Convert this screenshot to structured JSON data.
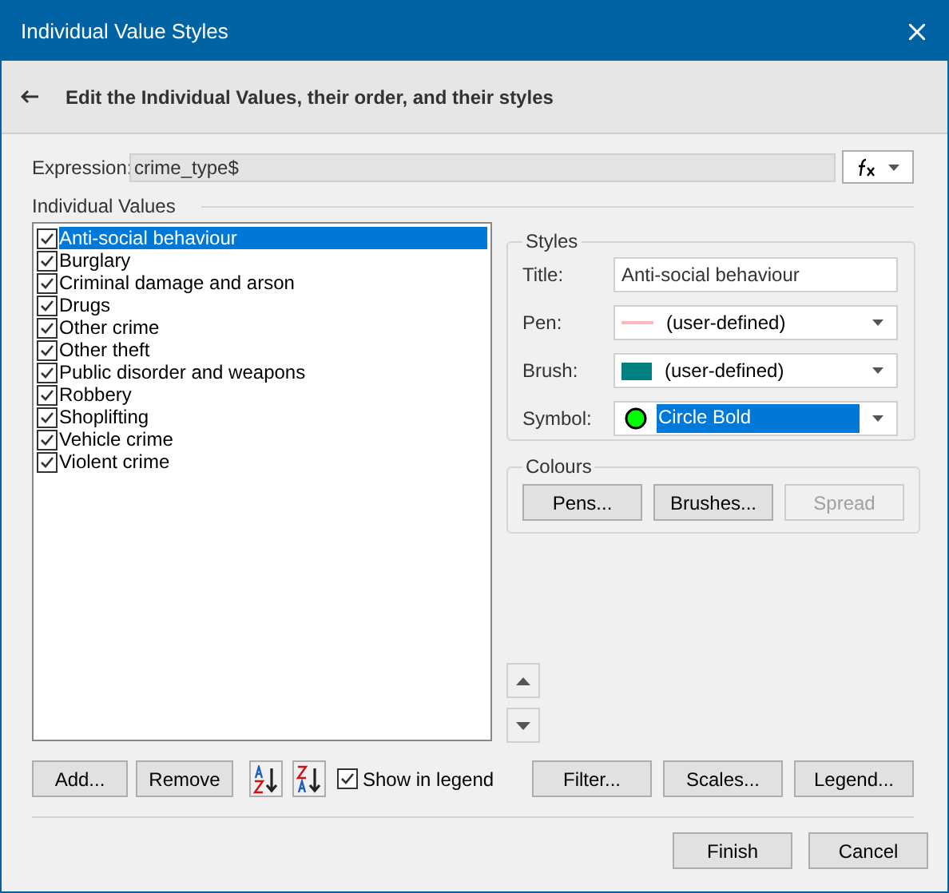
{
  "window": {
    "title": "Individual Value Styles"
  },
  "header": {
    "title": "Edit the Individual Values, their order, and their styles"
  },
  "expression": {
    "label": "Expression:",
    "value": "crime_type$"
  },
  "values_section": {
    "label": "Individual Values"
  },
  "values": [
    {
      "label": "Anti-social behaviour",
      "checked": true,
      "selected": true
    },
    {
      "label": "Burglary",
      "checked": true,
      "selected": false
    },
    {
      "label": "Criminal damage and arson",
      "checked": true,
      "selected": false
    },
    {
      "label": "Drugs",
      "checked": true,
      "selected": false
    },
    {
      "label": "Other crime",
      "checked": true,
      "selected": false
    },
    {
      "label": "Other theft",
      "checked": true,
      "selected": false
    },
    {
      "label": "Public disorder and weapons",
      "checked": true,
      "selected": false
    },
    {
      "label": "Robbery",
      "checked": true,
      "selected": false
    },
    {
      "label": "Shoplifting",
      "checked": true,
      "selected": false
    },
    {
      "label": "Vehicle crime",
      "checked": true,
      "selected": false
    },
    {
      "label": "Violent crime",
      "checked": true,
      "selected": false
    }
  ],
  "styles": {
    "title": "Styles",
    "fields": [
      {
        "kind": "text",
        "label": "Title:",
        "value": "Anti-social behaviour"
      },
      {
        "kind": "pen",
        "label": "Pen:",
        "value": "(user-defined)",
        "color": "#ffb6b6"
      },
      {
        "kind": "brush",
        "label": "Brush:",
        "value": "(user-defined)",
        "color": "#008080"
      },
      {
        "kind": "symbol",
        "label": "Symbol:",
        "value": "Circle Bold",
        "color": "#00ff00"
      }
    ]
  },
  "colours": {
    "title": "Colours",
    "buttons": [
      {
        "label": "Pens...",
        "disabled": false
      },
      {
        "label": "Brushes...",
        "disabled": false
      },
      {
        "label": "Spread",
        "disabled": true
      }
    ]
  },
  "list_buttons": {
    "add": "Add...",
    "remove": "Remove"
  },
  "show_in_legend": {
    "label": "Show in legend",
    "checked": true
  },
  "right_buttons": [
    "Filter...",
    "Scales...",
    "Legend..."
  ],
  "footer_buttons": [
    "Finish",
    "Cancel"
  ]
}
